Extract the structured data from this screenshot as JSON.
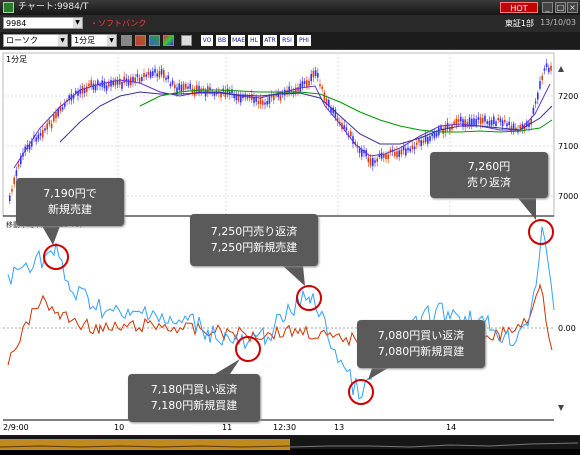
{
  "window": {
    "title": "チャート:9984/T",
    "hot_label": "HOT"
  },
  "header": {
    "symbol": "9984",
    "name": "・ソフトバンク",
    "market": "東証1部",
    "date": "13/10/03"
  },
  "toolbar": {
    "chart_type": "ローソク",
    "interval": "1分足",
    "indicators": [
      "VO",
      "BB",
      "MAE",
      "HL",
      "ATR",
      "RSI",
      "PHI"
    ]
  },
  "chart": {
    "interval_label": "1分足",
    "price_ticks": [
      "7200",
      "7100",
      "7000"
    ],
    "osc_label": "移動平均乖離 (5 25 75)",
    "osc_zero": "0.00",
    "time_labels": [
      "2/9:00",
      "10",
      "11",
      "12:30",
      "13",
      "14"
    ]
  },
  "annotations": [
    {
      "line1": "7,190円で",
      "line2": "新規売建"
    },
    {
      "line1": "7,250円売り返済",
      "line2": "7,250円新規売建"
    },
    {
      "line1": "7,180円買い返済",
      "line2": "7,180円新規買建"
    },
    {
      "line1": "7,080円買い返済",
      "line2": "7,080円新規買建"
    },
    {
      "line1": "7,260円",
      "line2": "売り返済"
    }
  ],
  "colors": {
    "up": "#e04000",
    "down": "#3333ff",
    "ma_short": "#6633cc",
    "ma_mid": "#333399",
    "ma_long": "#009900",
    "osc_blue": "#33a0ff",
    "osc_red": "#cc3300",
    "marker": "#cc0000"
  }
}
